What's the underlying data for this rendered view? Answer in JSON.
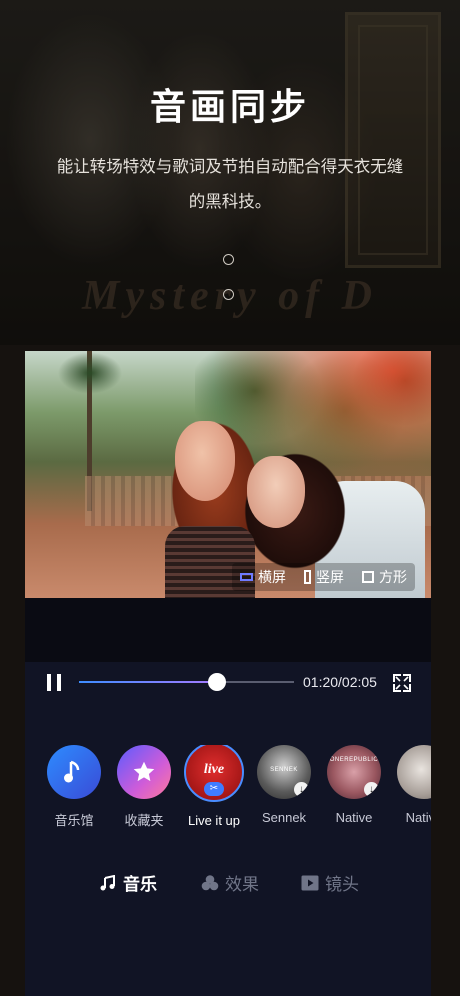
{
  "hero": {
    "title": "音画同步",
    "description_line1": "能让转场特效与歌词及节拍自动配合得天衣无缝",
    "description_line2": "的黑科技。",
    "background_text": "Mystery of D",
    "pager_dots": 2
  },
  "video": {
    "aspect_options": [
      {
        "label": "横屏",
        "icon": "landscape-icon",
        "selected": true
      },
      {
        "label": "竖屏",
        "icon": "portrait-icon",
        "selected": false
      },
      {
        "label": "方形",
        "icon": "square-icon",
        "selected": false
      }
    ]
  },
  "player": {
    "state_icon": "pause-icon",
    "time_display": "01:20/02:05",
    "progress_fraction": 0.64,
    "accent_start": "#3e8dff",
    "accent_end": "#a67bff"
  },
  "music": {
    "items": [
      {
        "label": "音乐馆",
        "icon": "music-note-icon"
      },
      {
        "label": "收藏夹",
        "icon": "star-icon"
      },
      {
        "label": "Live it up",
        "cover_text": "live",
        "selected": true
      },
      {
        "label": "Sennek",
        "cover_text": "SENNEK"
      },
      {
        "label": "Native",
        "cover_text": "ONEREPUBLIC"
      },
      {
        "label": "Native"
      }
    ]
  },
  "tabs": [
    {
      "label": "音乐",
      "icon": "music-note-icon",
      "active": true
    },
    {
      "label": "效果",
      "icon": "effects-icon",
      "active": false
    },
    {
      "label": "镜头",
      "icon": "play-icon",
      "active": false
    }
  ]
}
